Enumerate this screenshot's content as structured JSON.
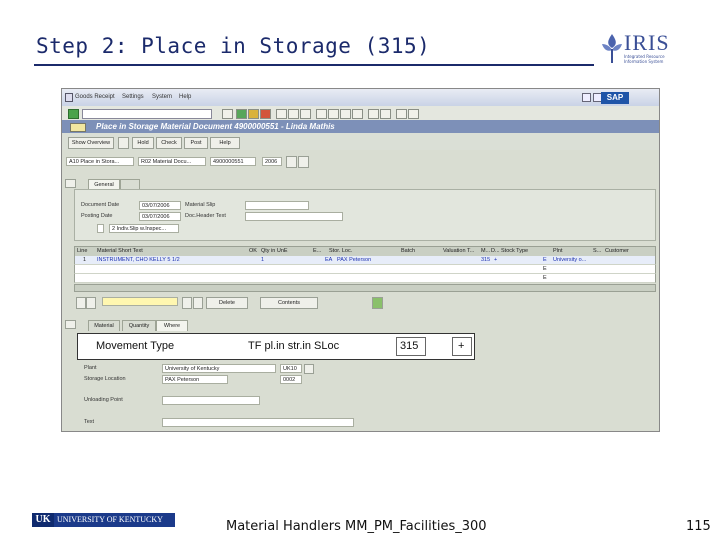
{
  "slide": {
    "title": "Step 2: Place in Storage (315)",
    "logo_word": "IRIS",
    "logo_sub": "Integrated Resource Information System",
    "footer_logo_text": "UNIVERSITY OF KENTUCKY",
    "footer_logo_mark": "UK",
    "footer": "Material Handlers MM_PM_Facilities_300",
    "page_number": "115"
  },
  "sap": {
    "menu": [
      "Goods Receipt",
      "Settings",
      "System",
      "Help"
    ],
    "sap_logo": "SAP",
    "window_title": "Place in Storage Material Document 4900000551 - Linda Mathis",
    "app_buttons": [
      "Show Overview",
      "Hold",
      "Check",
      "Post",
      "Help"
    ],
    "header": {
      "action": "A10 Place in Stora...",
      "reference": "R02 Material Docu...",
      "doc_number": "4900000551",
      "year": "2006"
    },
    "general_tab": "General",
    "document_date_label": "Document Date",
    "document_date": "03/07/2006",
    "posting_date_label": "Posting Date",
    "posting_date": "03/07/2006",
    "material_slip_label": "Material Slip",
    "doc_header_text_label": "Doc.Header Text",
    "print_option": "2 Indiv.Slip w.Inspec...",
    "grid_headers": [
      "Line",
      "Material Short Text",
      "OK",
      "Qty in UnE",
      "E...",
      "Stor. Loc.",
      "Batch",
      "Valuation T...",
      "M...",
      "D...",
      "Stock Type",
      "Plnt",
      "S...",
      "Customer"
    ],
    "grid_row": {
      "line": "1",
      "material": "INSTRUMENT, CHO KELLY 5 1/2",
      "qty": "1",
      "unit": "EA",
      "sloc": "PAX Peterson",
      "mvt": "315",
      "d": "+",
      "stock_type": "E",
      "plant": "University o..."
    },
    "blank_stock_types": [
      "E",
      "E"
    ],
    "bottom_buttons": [
      "Delete",
      "Contents"
    ],
    "detail_tabs": [
      "Material",
      "Quantity",
      "Where"
    ],
    "movement_type_label": "Movement Type",
    "movement_type_text": "TF pl.in str.in SLoc",
    "movement_type_code": "315",
    "movement_type_sign": "+",
    "plant_label": "Plant",
    "plant_value": "University of Kentucky",
    "plant_code": "UK10",
    "storage_location_label": "Storage Location",
    "storage_location_value": "PAX Peterson",
    "storage_location_code": "0002",
    "unloading_point_label": "Unloading Point",
    "text_label": "Text"
  }
}
